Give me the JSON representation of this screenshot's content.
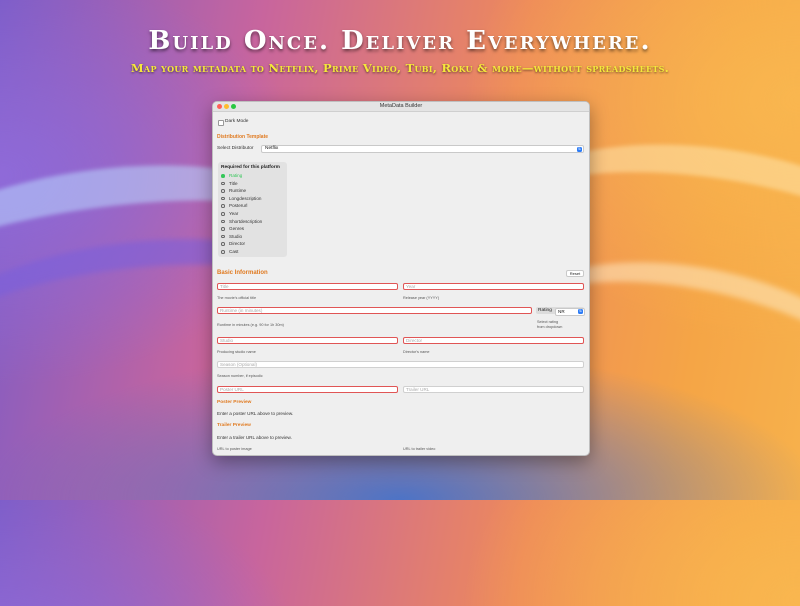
{
  "marketing": {
    "headline": "Build Once. Deliver Everywhere.",
    "subheadline": "Map your metadata to Netflix, Prime Video, Tubi, Roku & more—without spreadsheets."
  },
  "window": {
    "title": "MetaData Builder"
  },
  "settings": {
    "dark_mode_label": "Dark Mode",
    "dark_mode_checked": false
  },
  "distribution": {
    "section_title": "Distribution Template",
    "select_label": "Select Distributor",
    "selected_value": "Netflix"
  },
  "required": {
    "title": "Required for this platform",
    "items": [
      {
        "label": "Rating",
        "done": true
      },
      {
        "label": "Title",
        "done": false
      },
      {
        "label": "Runtime",
        "done": false
      },
      {
        "label": "Longdescription",
        "done": false
      },
      {
        "label": "Posterurl",
        "done": false
      },
      {
        "label": "Year",
        "done": false
      },
      {
        "label": "Shortdescription",
        "done": false
      },
      {
        "label": "Genres",
        "done": false
      },
      {
        "label": "Studio",
        "done": false
      },
      {
        "label": "Director",
        "done": false
      },
      {
        "label": "Cast",
        "done": false
      }
    ]
  },
  "basic": {
    "section_title": "Basic Information",
    "reset_label": "Reset",
    "title_placeholder": "Title",
    "title_help": "The movie's official title",
    "year_placeholder": "Year",
    "year_help": "Release year (YYYY)",
    "runtime_placeholder": "Runtime (in minutes)",
    "runtime_help": "Runtime in minutes (e.g. 90 for 1h 30m)",
    "rating_label": "Rating",
    "rating_value": "NR",
    "rating_help_line1": "Select rating",
    "rating_help_line2": "from dropdown",
    "studio_placeholder": "Studio",
    "studio_help": "Producing studio name",
    "director_placeholder": "Director",
    "director_help": "Director's name",
    "season_placeholder": "Season (Optional)",
    "season_help": "Season number, if episodic",
    "poster_placeholder": "Poster URL",
    "trailer_placeholder": "Trailer URL"
  },
  "poster_preview": {
    "title": "Poster Preview",
    "message": "Enter a poster URL above to preview."
  },
  "trailer_preview": {
    "title": "Trailer Preview",
    "message": "Enter a trailer URL above to preview."
  },
  "footer": {
    "poster_help": "URL to poster image",
    "trailer_help": "URL to trailer video"
  },
  "colors": {
    "accent": "#e07a20",
    "error_border": "#e05555",
    "success": "#34c759",
    "control_blue": "#2d7cf6"
  }
}
